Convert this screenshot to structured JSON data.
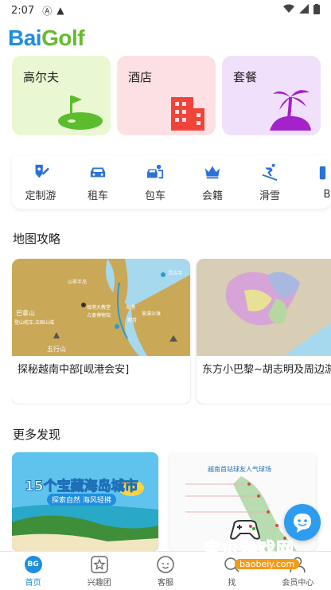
{
  "status_bar": {
    "time": "2:07"
  },
  "app": {
    "logo_part1": "Bai",
    "logo_part2": "Golf"
  },
  "categories": [
    {
      "label": "高尔夫",
      "color": "#e9f8d3"
    },
    {
      "label": "酒店",
      "color": "#fde0e3"
    },
    {
      "label": "套餐",
      "color": "#f0e0fc"
    }
  ],
  "services": [
    {
      "label": "定制游",
      "icon": "pen-pin-icon"
    },
    {
      "label": "租车",
      "icon": "car-icon"
    },
    {
      "label": "包车",
      "icon": "driver-car-icon"
    },
    {
      "label": "会籍",
      "icon": "crown-icon"
    },
    {
      "label": "滑雪",
      "icon": "skier-icon"
    },
    {
      "label": "B",
      "icon": "more-icon"
    }
  ],
  "sections": {
    "guides_title": "地图攻略",
    "discover_title": "更多发现"
  },
  "guides": [
    {
      "caption": "探秘越南中部[岘港会安]",
      "map_labels": {
        "l1": "巴拿山",
        "l2": "登山缆车,法国山城",
        "l3": "山茶半岛",
        "l4": "岘港大教堂",
        "l5": "占婆博物馆",
        "l6": "美溪沙滩",
        "l7": "观音",
        "l8": "五行山",
        "l9": "海港",
        "l10": "灵应寺"
      }
    },
    {
      "caption": "东方小巴黎~胡志明及周边游场"
    }
  ],
  "discover": [
    {
      "banner_text": "15个宝藏海岛城市",
      "banner_sub": "探索自然 海风轻拂"
    },
    {
      "map_title": "越南首站球友人气球场"
    }
  ],
  "tabbar": [
    {
      "label": "首页",
      "active": true,
      "icon": "home-bg-icon"
    },
    {
      "label": "兴趣团",
      "icon": "star-icon"
    },
    {
      "label": "客服",
      "icon": "chat-face-icon"
    },
    {
      "label": "找",
      "icon": "find-icon"
    },
    {
      "label": "会员中心",
      "icon": "user-icon"
    }
  ],
  "home_badge": "BG",
  "watermark": {
    "text": "宝贝游戏网",
    "url": "baobeiy.com"
  }
}
